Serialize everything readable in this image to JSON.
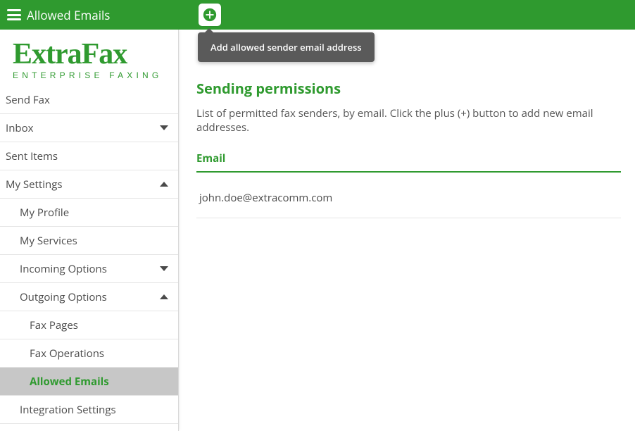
{
  "topbar": {
    "title": "Allowed Emails",
    "tooltip_text": "Add allowed sender email address"
  },
  "logo": {
    "main": "ExtraFax",
    "sub": "ENTERPRISE FAXING"
  },
  "sidebar": {
    "send_fax": "Send Fax",
    "inbox": "Inbox",
    "sent_items": "Sent Items",
    "my_settings": "My Settings",
    "my_profile": "My Profile",
    "my_services": "My Services",
    "incoming_options": "Incoming Options",
    "outgoing_options": "Outgoing Options",
    "fax_pages": "Fax Pages",
    "fax_operations": "Fax Operations",
    "allowed_emails": "Allowed Emails",
    "integration_settings": "Integration Settings"
  },
  "main": {
    "heading": "Sending permissions",
    "description": "List of permitted fax senders, by email. Click the plus (+) button to add new email addresses.",
    "column_header": "Email",
    "emails": [
      "john.doe@extracomm.com"
    ]
  },
  "colors": {
    "brand_green": "#2f9a2f",
    "tooltip_bg": "#5a5a5a"
  }
}
